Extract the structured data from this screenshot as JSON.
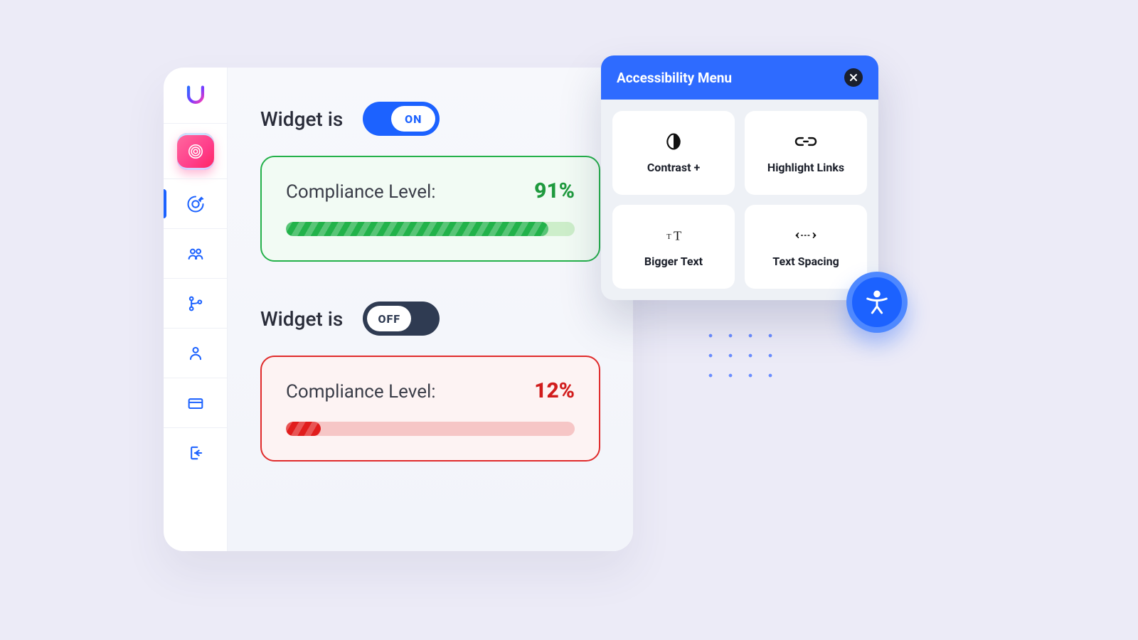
{
  "sidebar": {
    "items": [
      {
        "name": "logo",
        "kind": "logo"
      },
      {
        "name": "app-tile",
        "kind": "app"
      },
      {
        "name": "target",
        "kind": "nav",
        "active": true
      },
      {
        "name": "users",
        "kind": "nav"
      },
      {
        "name": "branches",
        "kind": "nav"
      },
      {
        "name": "profile",
        "kind": "nav"
      },
      {
        "name": "billing",
        "kind": "nav"
      },
      {
        "name": "logout",
        "kind": "nav"
      }
    ]
  },
  "widgets": [
    {
      "label": "Widget is",
      "state": "ON",
      "state_on": true,
      "card": {
        "title": "Compliance Level:",
        "value": "91%",
        "percent": 91,
        "tone": "good"
      }
    },
    {
      "label": "Widget is",
      "state": "OFF",
      "state_on": false,
      "card": {
        "title": "Compliance Level:",
        "value": "12%",
        "percent": 12,
        "tone": "bad"
      }
    }
  ],
  "popup": {
    "title": "Accessibility Menu",
    "tiles": [
      {
        "label": "Contrast +",
        "icon": "contrast"
      },
      {
        "label": "Highlight Links",
        "icon": "link"
      },
      {
        "label": "Bigger Text",
        "icon": "biggerT"
      },
      {
        "label": "Text Spacing",
        "icon": "spacing"
      }
    ]
  }
}
